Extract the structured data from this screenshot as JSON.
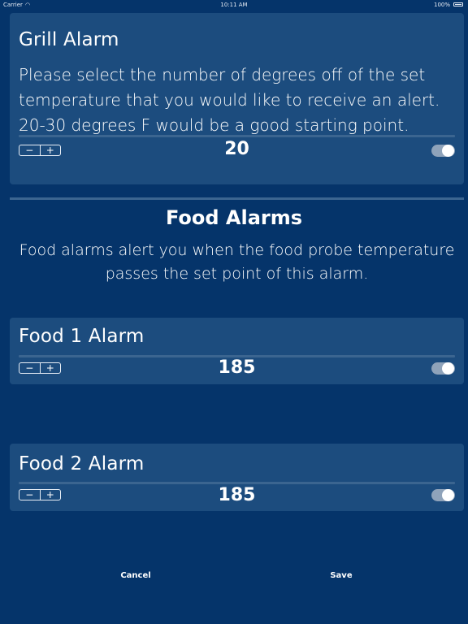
{
  "status_bar": {
    "carrier": "Carrier",
    "time": "10:11 AM",
    "battery": "100%"
  },
  "grill_alarm": {
    "title": "Grill Alarm",
    "description": "Please select the number of degrees off of the set temperature that you would like to receive an alert. 20-30 degrees F would be a good starting point.",
    "value": "20",
    "stepper_minus": "−",
    "stepper_plus": "+",
    "enabled": true
  },
  "food_section": {
    "heading": "Food Alarms",
    "description": "Food alarms alert you when the food probe temperature passes the set point of this alarm."
  },
  "food1_alarm": {
    "title": "Food 1 Alarm",
    "value": "185",
    "stepper_minus": "−",
    "stepper_plus": "+",
    "enabled": true
  },
  "food2_alarm": {
    "title": "Food 2 Alarm",
    "value": "185",
    "stepper_minus": "−",
    "stepper_plus": "+",
    "enabled": true
  },
  "footer": {
    "cancel_label": "Cancel",
    "save_label": "Save"
  }
}
